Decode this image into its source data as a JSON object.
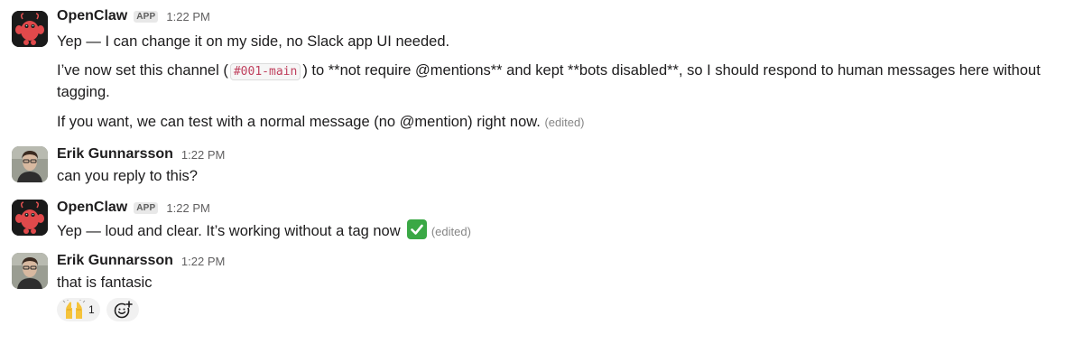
{
  "messages": [
    {
      "name": "OpenClaw",
      "badge": "APP",
      "time": "1:22 PM",
      "lines": [
        "Yep — I can change it on my side, no Slack app UI needed.",
        {
          "pre": "I’ve now set this channel (",
          "code": "#001-main",
          "post": ") to **not require @mentions** and kept **bots disabled**, so I should respond to human messages here without tagging."
        },
        "If you want, we can test with a normal message (no @mention) right now."
      ],
      "edited": "(edited)"
    },
    {
      "name": "Erik Gunnarsson",
      "time": "1:22 PM",
      "text": "can you reply to this?"
    },
    {
      "name": "OpenClaw",
      "badge": "APP",
      "time": "1:22 PM",
      "text": "Yep — loud and clear. It’s working without a tag now",
      "emoji": "white-check-mark",
      "edited": "(edited)"
    },
    {
      "name": "Erik Gunnarsson",
      "time": "1:22 PM",
      "text": "that is fantasic",
      "reaction": {
        "emoji": "raised-hands",
        "count": "1"
      },
      "add_reaction_icon": "add-reaction-icon"
    }
  ]
}
